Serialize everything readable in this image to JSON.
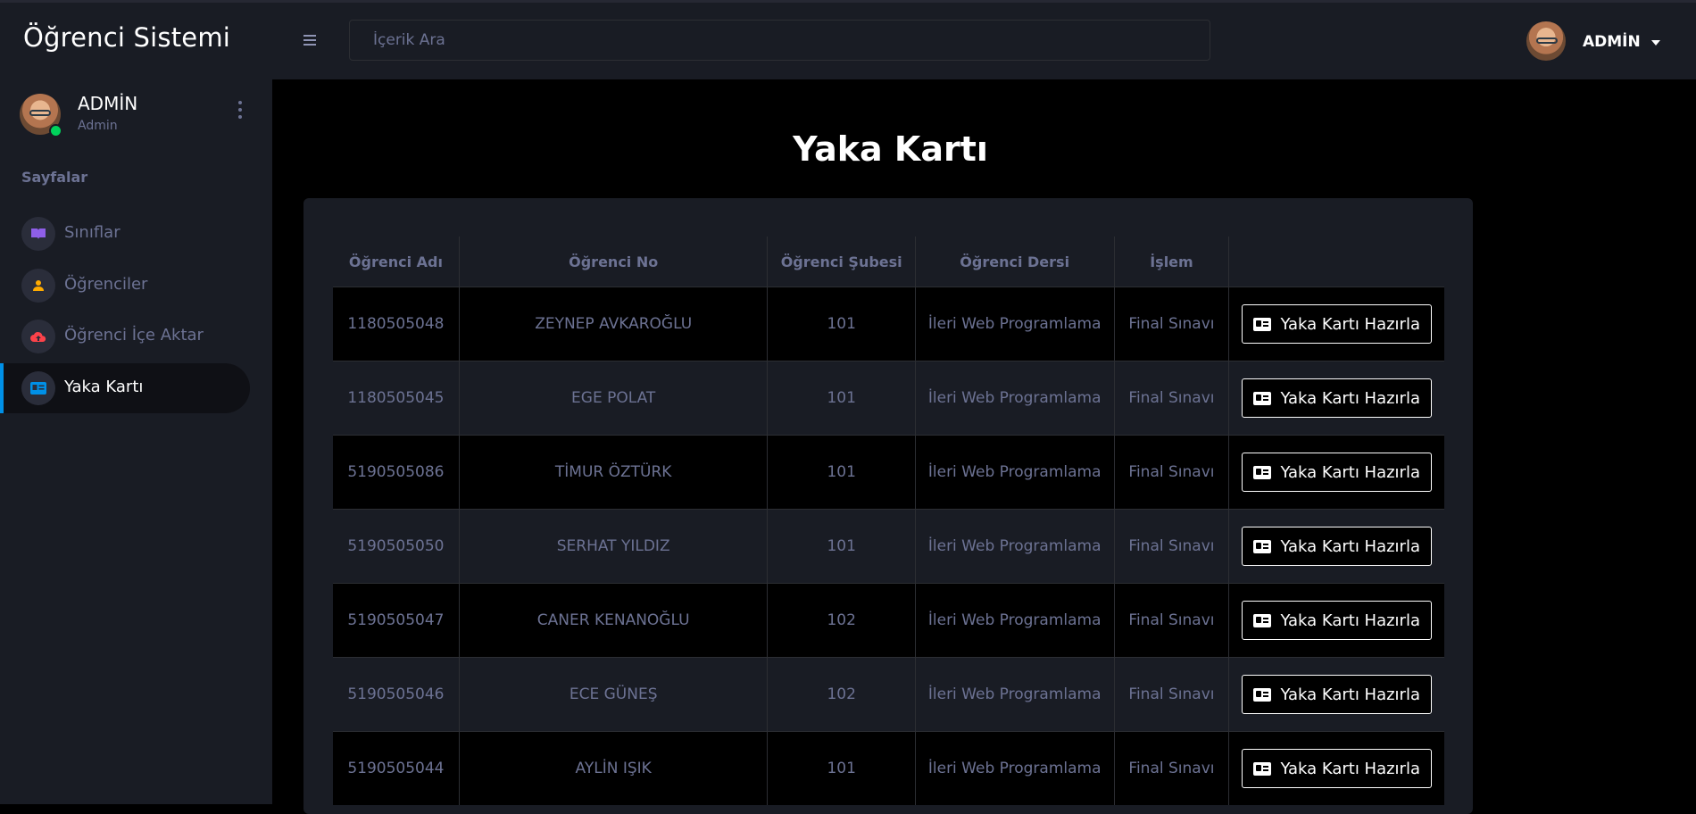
{
  "app": {
    "title": "Öğrenci Sistemi"
  },
  "colors": {
    "accent": "#0090e7",
    "online": "#00d25b",
    "muted": "#6c7293",
    "sidebar_bg": "#191c24"
  },
  "sidebar": {
    "profile": {
      "name": "ADMİN",
      "role": "Admin"
    },
    "section_title": "Sayfalar",
    "items": [
      {
        "label": "Sınıflar",
        "icon": "book-icon",
        "active": false
      },
      {
        "label": "Öğrenciler",
        "icon": "user-icon",
        "active": false
      },
      {
        "label": "Öğrenci İçe Aktar",
        "icon": "cloud-upload-icon",
        "active": false
      },
      {
        "label": "Yaka Kartı",
        "icon": "id-card-icon",
        "active": true
      }
    ]
  },
  "header": {
    "search_placeholder": "İçerik Ara",
    "user_name": "ADMİN"
  },
  "main": {
    "title": "Yaka Kartı",
    "table": {
      "columns": [
        "Öğrenci Adı",
        "Öğrenci No",
        "Öğrenci Şubesi",
        "Öğrenci Dersi",
        "İşlem",
        ""
      ],
      "button_label": "Yaka Kartı Hazırla",
      "rows": [
        {
          "no": "1180505048",
          "name": "ZEYNEP AVKAROĞLU",
          "sube": "101",
          "ders": "İleri Web Programlama",
          "islem": "Final Sınavı"
        },
        {
          "no": "1180505045",
          "name": "EGE POLAT",
          "sube": "101",
          "ders": "İleri Web Programlama",
          "islem": "Final Sınavı"
        },
        {
          "no": "5190505086",
          "name": "TİMUR ÖZTÜRK",
          "sube": "101",
          "ders": "İleri Web Programlama",
          "islem": "Final Sınavı"
        },
        {
          "no": "5190505050",
          "name": "SERHAT YILDIZ",
          "sube": "101",
          "ders": "İleri Web Programlama",
          "islem": "Final Sınavı"
        },
        {
          "no": "5190505047",
          "name": "CANER KENANOĞLU",
          "sube": "102",
          "ders": "İleri Web Programlama",
          "islem": "Final Sınavı"
        },
        {
          "no": "5190505046",
          "name": "ECE GÜNEŞ",
          "sube": "102",
          "ders": "İleri Web Programlama",
          "islem": "Final Sınavı"
        },
        {
          "no": "5190505044",
          "name": "AYLİN IŞIK",
          "sube": "101",
          "ders": "İleri Web Programlama",
          "islem": "Final Sınavı"
        }
      ]
    }
  }
}
